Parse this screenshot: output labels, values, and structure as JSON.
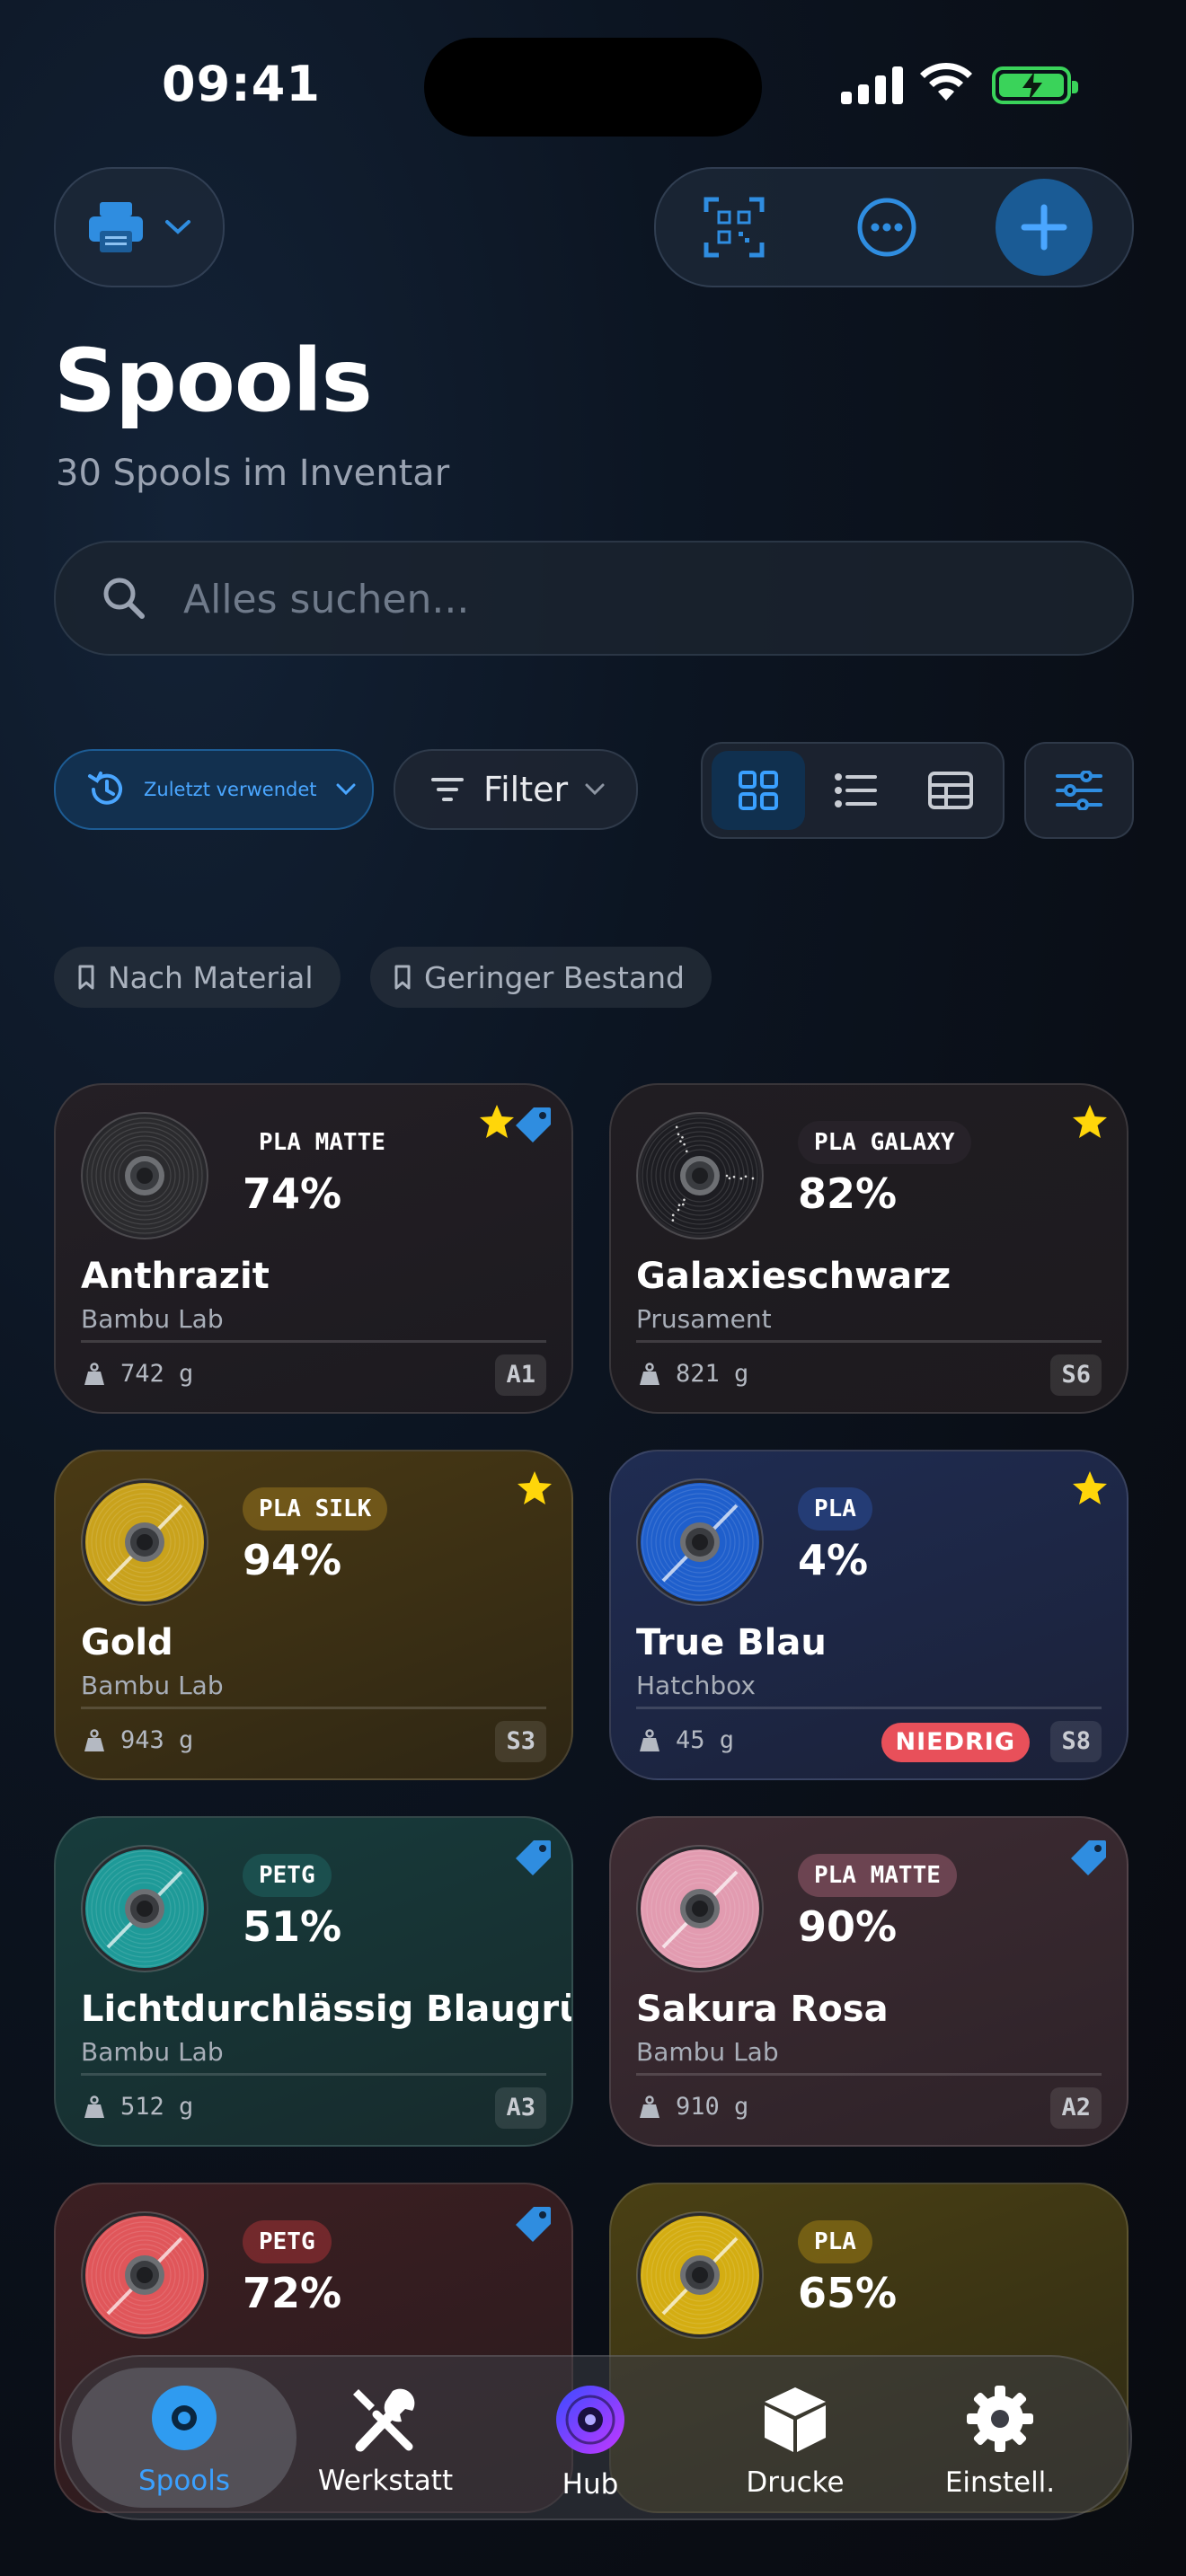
{
  "status_bar": {
    "time": "09:41"
  },
  "header": {
    "title": "Spools",
    "subtitle": "30 Spools im Inventar"
  },
  "search": {
    "placeholder": "Alles suchen..."
  },
  "toolbar": {
    "sort_label": "Zuletzt verwendet",
    "filter_label": "Filter",
    "view_modes": [
      "grid",
      "list",
      "table"
    ],
    "active_view": "grid"
  },
  "quick_filters": [
    "Nach Material",
    "Geringer Bestand"
  ],
  "spools": [
    {
      "name": "Anthrazit",
      "brand": "Bambu Lab",
      "material": "PLA MATTE",
      "percent": "74%",
      "weight": "742 g",
      "slot": "A1",
      "favorite": true,
      "tagged": true,
      "low": false,
      "color": "#2b2b2e"
    },
    {
      "name": "Galaxieschwarz",
      "brand": "Prusament",
      "material": "PLA GALAXY",
      "percent": "82%",
      "weight": "821 g",
      "slot": "S6",
      "favorite": true,
      "tagged": false,
      "low": false,
      "color": "#1d1d22"
    },
    {
      "name": "Gold",
      "brand": "Bambu Lab",
      "material": "PLA SILK",
      "percent": "94%",
      "weight": "943 g",
      "slot": "S3",
      "favorite": true,
      "tagged": false,
      "low": false,
      "color": "#c9a21c"
    },
    {
      "name": "True Blau",
      "brand": "Hatchbox",
      "material": "PLA",
      "percent": "4%",
      "weight": "45 g",
      "slot": "S8",
      "favorite": true,
      "tagged": false,
      "low": true,
      "low_label": "NIEDRIG",
      "color": "#1f5fcc"
    },
    {
      "name": "Lichtdurchlässig Blaugrün",
      "brand": "Bambu Lab",
      "material": "PETG",
      "percent": "51%",
      "weight": "512 g",
      "slot": "A3",
      "favorite": false,
      "tagged": true,
      "low": false,
      "color": "#1e9a98"
    },
    {
      "name": "Sakura Rosa",
      "brand": "Bambu Lab",
      "material": "PLA MATTE",
      "percent": "90%",
      "weight": "910 g",
      "slot": "A2",
      "favorite": false,
      "tagged": true,
      "low": false,
      "color": "#e29bb0"
    },
    {
      "name": "",
      "brand": "",
      "material": "PETG",
      "percent": "72%",
      "weight": "",
      "slot": "",
      "favorite": false,
      "tagged": true,
      "low": false,
      "color": "#e0565a"
    },
    {
      "name": "",
      "brand": "",
      "material": "PLA",
      "percent": "65%",
      "weight": "",
      "slot": "",
      "favorite": false,
      "tagged": false,
      "low": false,
      "color": "#d4ad12"
    }
  ],
  "tabbar": {
    "items": [
      "Spools",
      "Werkstatt",
      "Hub",
      "Drucke",
      "Einstell."
    ],
    "active": "Spools"
  },
  "colors": {
    "accent": "#3aa0ff",
    "star": "#ffd60a",
    "low_badge": "#e8505a"
  }
}
